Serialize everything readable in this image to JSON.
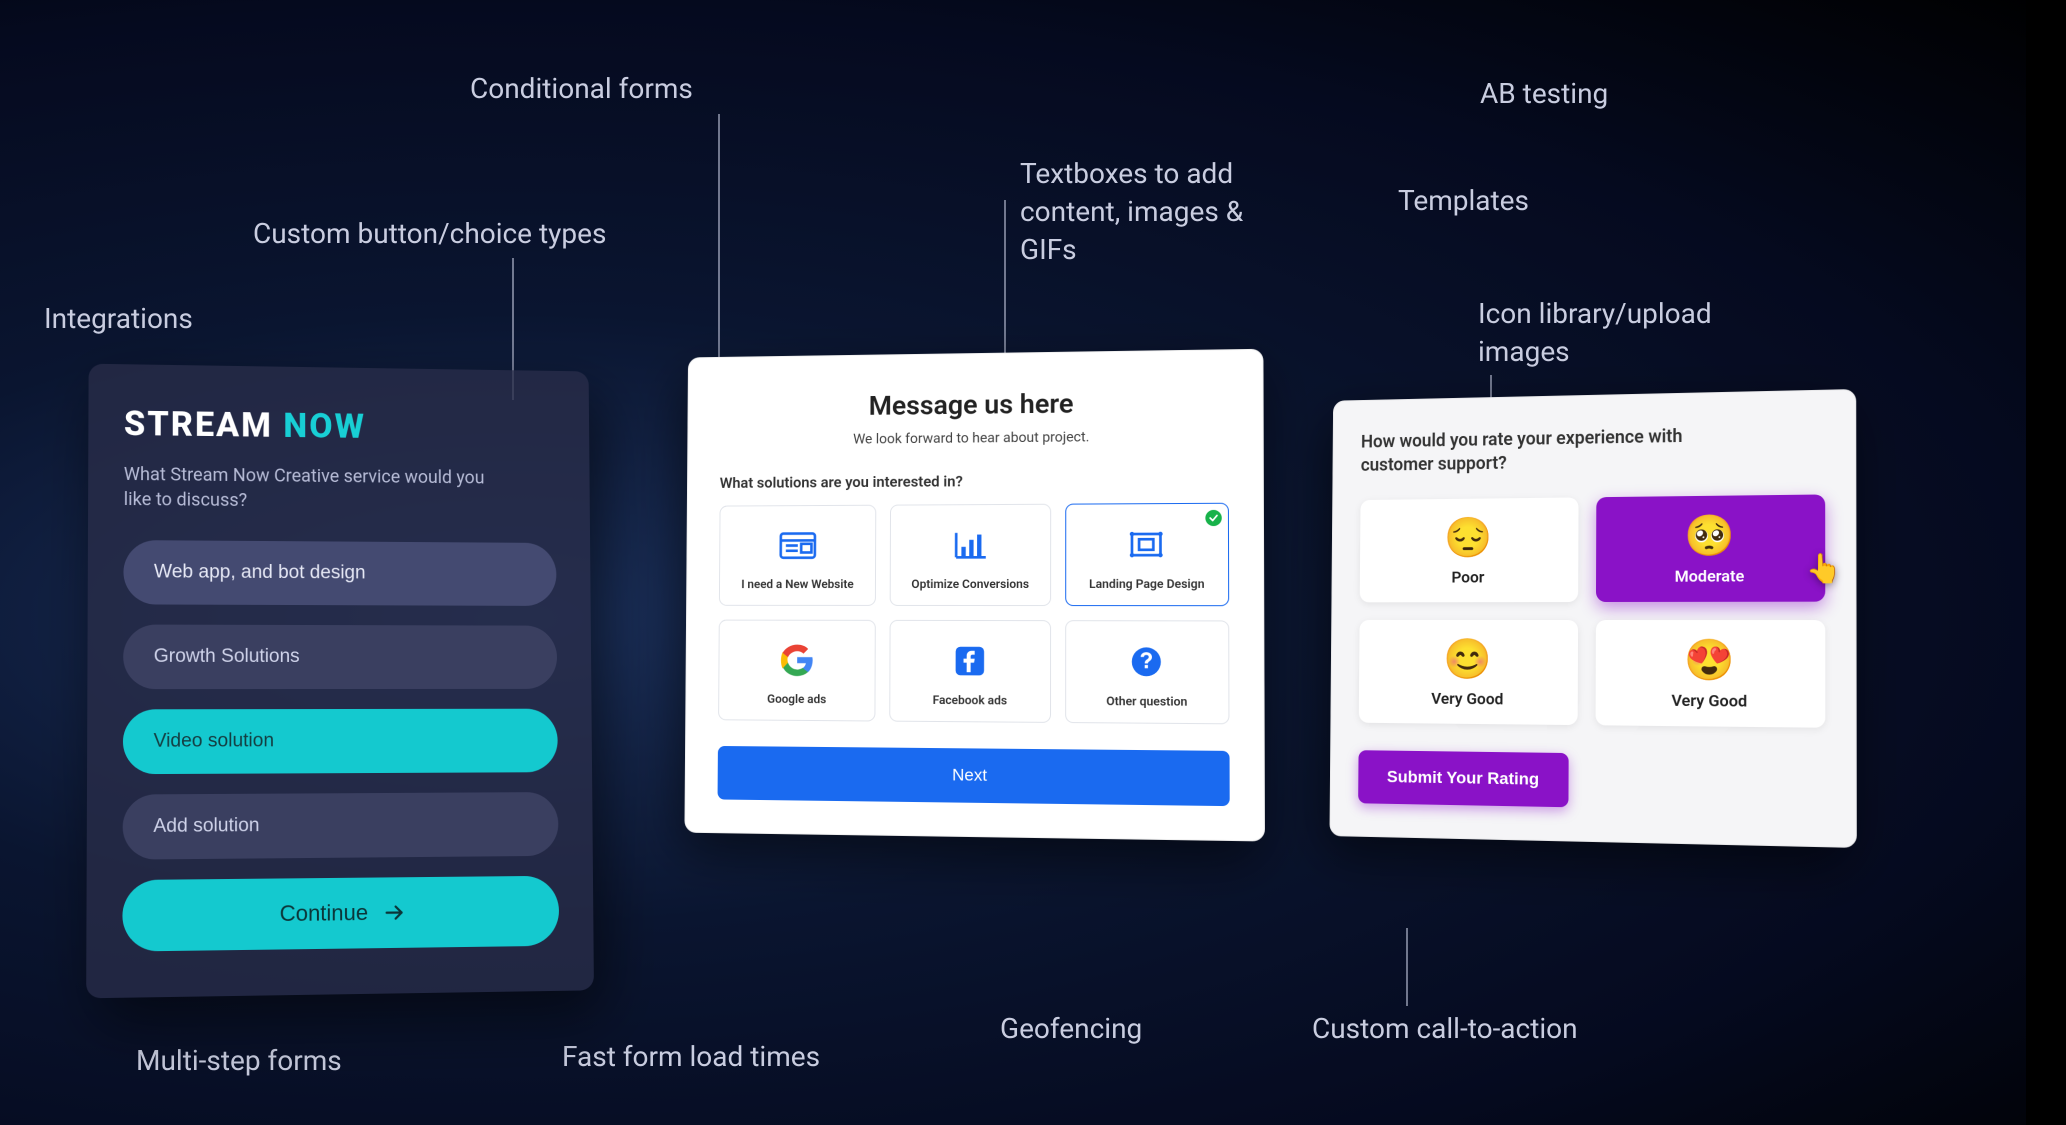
{
  "labels": {
    "conditional_forms": "Conditional forms",
    "custom_button_types": "Custom button/choice types",
    "integrations": "Integrations",
    "textboxes": "Textboxes to add\ncontent, images &\nGIFs",
    "ab_testing": "AB testing",
    "templates": "Templates",
    "icon_library": "Icon library/upload\nimages",
    "multi_step": "Multi-step forms",
    "fast_load": "Fast form load times",
    "geofencing": "Geofencing",
    "custom_cta": "Custom call-to-action"
  },
  "cardA": {
    "brand_part1": "STREAM ",
    "brand_part2": "NOW",
    "question": "What Stream Now Creative service would you like to discuss?",
    "options": [
      {
        "label": "Web app, and bot design",
        "selected": false,
        "highlight": true
      },
      {
        "label": "Growth Solutions",
        "selected": false,
        "highlight": false
      },
      {
        "label": "Video solution",
        "selected": true,
        "highlight": false
      },
      {
        "label": "Add solution",
        "selected": false,
        "highlight": false
      }
    ],
    "continue_label": "Continue"
  },
  "cardB": {
    "title": "Message us here",
    "subtitle": "We look forward to hear about project.",
    "ask": "What solutions are you interested in?",
    "tiles": [
      {
        "icon": "website",
        "label": "I need a New Website",
        "selected": false
      },
      {
        "icon": "chart",
        "label": "Optimize Conversions",
        "selected": false
      },
      {
        "icon": "landing",
        "label": "Landing Page Design",
        "selected": true
      },
      {
        "icon": "google",
        "label": "Google ads",
        "selected": false
      },
      {
        "icon": "facebook",
        "label": "Facebook ads",
        "selected": false
      },
      {
        "icon": "question",
        "label": "Other question",
        "selected": false
      }
    ],
    "next_label": "Next"
  },
  "cardC": {
    "question": "How would you rate your experience with customer support?",
    "ratings": [
      {
        "emoji": "😔",
        "label": "Poor",
        "selected": false
      },
      {
        "emoji": "🥺",
        "label": "Moderate",
        "selected": true
      },
      {
        "emoji": "😊",
        "label": "Very Good",
        "selected": false
      },
      {
        "emoji": "😍",
        "label": "Very Good",
        "selected": false
      }
    ],
    "submit_label": "Submit Your Rating"
  }
}
